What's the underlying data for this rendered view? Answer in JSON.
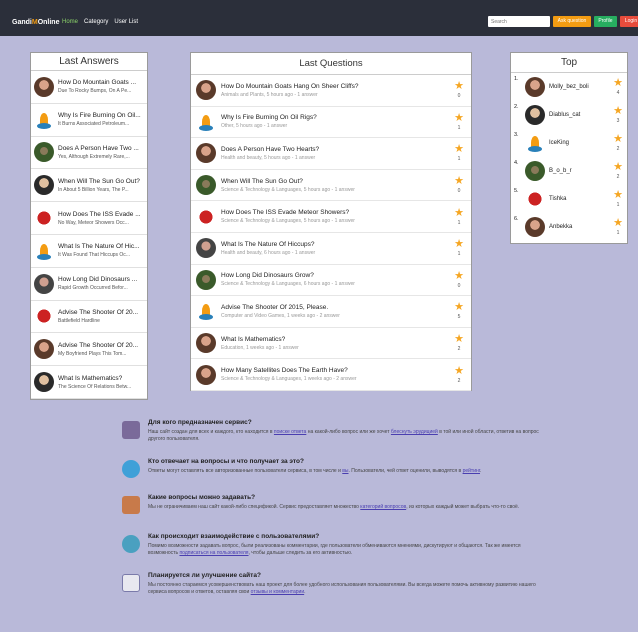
{
  "header": {
    "logo_main": "Gandi",
    "logo_accent": "M",
    "logo_tail": "Online",
    "nav": [
      "Home",
      "Category",
      "User List"
    ],
    "search_placeholder": "Search",
    "ask_label": "Ask question",
    "profile_label": "Profile",
    "login_label": "Login"
  },
  "left_panel": {
    "title": "Last Answers",
    "items": [
      {
        "title": "How Do Mountain Goats ...",
        "sub": "Due To Rocky Bumps, On A Pe..."
      },
      {
        "title": "Why Is Fire Burning On Oil...",
        "sub": "It Burns Associated Petroleum..."
      },
      {
        "title": "Does A Person Have Two ...",
        "sub": "Yes, Although Extremely Rare,..."
      },
      {
        "title": "When Will The Sun Go Out?",
        "sub": "In About 5 Billion Years, The P..."
      },
      {
        "title": "How Does The ISS Evade ...",
        "sub": "No Way, Meteor Showers Occ..."
      },
      {
        "title": "What Is The Nature Of Hic...",
        "sub": "It Was Found That Hiccups Oc..."
      },
      {
        "title": "How Long Did Dinosaurs ...",
        "sub": "Rapid Growth Occurred Befor..."
      },
      {
        "title": "Advise The Shooter Of 20...",
        "sub": "Battlefield Hardline"
      },
      {
        "title": "Advise The Shooter Of 20...",
        "sub": "My Boyfriend Plays This Tom..."
      },
      {
        "title": "What Is Mathematics?",
        "sub": "The Science Of Relations Betw..."
      }
    ]
  },
  "center_panel": {
    "title": "Last Questions",
    "items": [
      {
        "title": "How Do Mountain Goats Hang On Sheer Cliffs?",
        "meta": "Animals and Plants, 5 hours ago - 1 answer",
        "count": "0"
      },
      {
        "title": "Why Is Fire Burning On Oil Rigs?",
        "meta": "Other, 5 hours ago - 1 answer",
        "count": "1"
      },
      {
        "title": "Does A Person Have Two Hearts?",
        "meta": "Health and beauty, 5 hours ago - 1 answer",
        "count": "1"
      },
      {
        "title": "When Will The Sun Go Out?",
        "meta": "Science & Technology & Languages, 5 hours ago - 1 answer",
        "count": "0"
      },
      {
        "title": "How Does The ISS Evade Meteor Showers?",
        "meta": "Science & Technology & Languages, 5 hours ago - 1 answer",
        "count": "1"
      },
      {
        "title": "What Is The Nature Of Hiccups?",
        "meta": "Health and beauty, 6 hours ago - 1 answer",
        "count": "1"
      },
      {
        "title": "How Long Did Dinosaurs Grow?",
        "meta": "Science & Technology & Languages, 6 hours ago - 1 answer",
        "count": "0"
      },
      {
        "title": "Advise The Shooter Of 2015, Please.",
        "meta": "Computer and Video Games, 1 weeks ago - 2 answer",
        "count": "5"
      },
      {
        "title": "What Is Mathematics?",
        "meta": "Education, 1 weeks ago - 1 answer",
        "count": "2"
      },
      {
        "title": "How Many Satellites Does The Earth Have?",
        "meta": "Science & Technology & Languages, 1 weeks ago - 2 answer",
        "count": "2"
      }
    ]
  },
  "right_panel": {
    "title": "Top",
    "items": [
      {
        "rank": "1.",
        "name": "Molly_bez_boli",
        "score": "4"
      },
      {
        "rank": "2.",
        "name": "Diablus_cat",
        "score": "3"
      },
      {
        "rank": "3.",
        "name": "IceKing",
        "score": "2"
      },
      {
        "rank": "4.",
        "name": "B_o_b_r",
        "score": "2"
      },
      {
        "rank": "5.",
        "name": "Tishka",
        "score": "1"
      },
      {
        "rank": "6.",
        "name": "Anbekka",
        "score": "1"
      }
    ]
  },
  "info": [
    {
      "title": "Для кого предназначен сервис?",
      "icon": "person-icon",
      "b1": "Наш сайт создан для всех и каждого, кто находится в ",
      "l1": "поиске ответа",
      "b2": " на какой-либо вопрос или же хочет ",
      "l2": "блеснуть эрудицией",
      "b3": " в той или иной области, ответив на вопрос другого пользователя."
    },
    {
      "title": "Кто отвечает на вопросы и что получает за это?",
      "icon": "chat-icon",
      "b1": "Ответы могут оставлять все авторизованные пользователи сервиса, в том числе и ",
      "l1": "вы",
      "b2": ". Пользователи, чей ответ оценили, выводятся в ",
      "l2": "рейтинг",
      "b3": "."
    },
    {
      "title": "Какие вопросы можно задавать?",
      "icon": "clipboard-icon",
      "b1": "Мы не ограничиваем наш сайт какой-либо спецификой. Сервис предоставляет множество ",
      "l1": "категорий вопросов",
      "b2": ", из которых каждый может выбрать что-то своё.",
      "l2": "",
      "b3": ""
    },
    {
      "title": "Как происходит взаимодействие с пользователями?",
      "icon": "dialog-icon",
      "b1": "Помимо возможности задавать вопрос, были реализованы комментарии, где пользователи обмениваются мнениями, дискутируют и общаются. Так же имеется возможность ",
      "l1": "подписаться на пользователя",
      "b2": ", чтобы дальше следить за его активностью.",
      "l2": "",
      "b3": ""
    },
    {
      "title": "Планируется ли улучшение сайта?",
      "icon": "chart-icon",
      "b1": "Мы постоянно стараемся усовершенствовать наш проект для более удобного использования пользователями. Вы всегда можете помочь активному развитию нашего сервиса вопросов и ответов, оставляя свои ",
      "l1": "отзывы и комментарии",
      "b2": ".",
      "l2": "",
      "b3": ""
    }
  ],
  "colors": {
    "header_bg": "#2b2f3a",
    "page_bg": "#b9b9d9",
    "star": "#f5a623",
    "link": "#4a3fb0",
    "ask": "#f39c12",
    "profile": "#27ae60",
    "login": "#e74c3c"
  }
}
